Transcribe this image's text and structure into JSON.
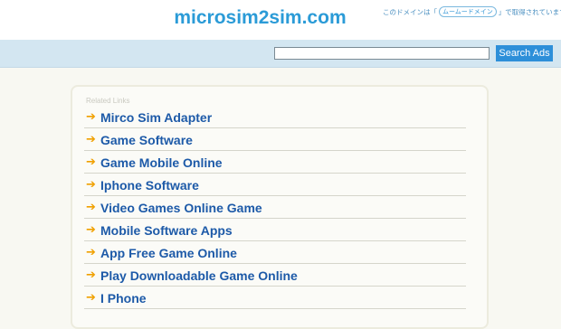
{
  "header": {
    "site_title": "microsim2sim.com",
    "jp_notice_before": "このドメインは「",
    "jp_logo": "ムームードメイン",
    "jp_notice_after": "」で取得されています"
  },
  "search": {
    "button_label": "Search Ads",
    "value": ""
  },
  "related": {
    "label": "Related Links",
    "arrow": "➔",
    "links": [
      "Mirco Sim Adapter",
      "Game Software",
      "Game Mobile Online",
      "Iphone Software",
      "Video Games Online Game",
      "Mobile Software Apps",
      "App Free Game Online",
      "Play Downloadable Game Online",
      "I Phone"
    ]
  }
}
